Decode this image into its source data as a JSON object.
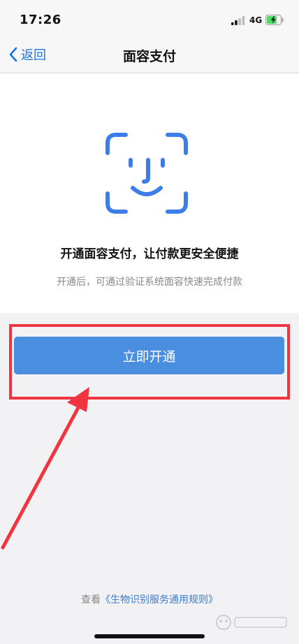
{
  "status_bar": {
    "time": "17:26",
    "network": "4G"
  },
  "nav": {
    "back_label": "返回",
    "title": "面容支付"
  },
  "card": {
    "headline": "开通面容支付，让付款更安全便捷",
    "subtext": "开通后，可通过验证系统面容快速完成付款"
  },
  "primary_button": {
    "label": "立即开通"
  },
  "footer": {
    "prefix": "查看",
    "link_text": "《生物识别服务通用规则》"
  },
  "colors": {
    "accent": "#4a8fdf",
    "link": "#3a7bd5",
    "annotation_red": "#f03440"
  },
  "icons": [
    "signal-icon",
    "battery-icon",
    "back-chevron-icon",
    "face-id-icon",
    "arrow-annotation"
  ]
}
